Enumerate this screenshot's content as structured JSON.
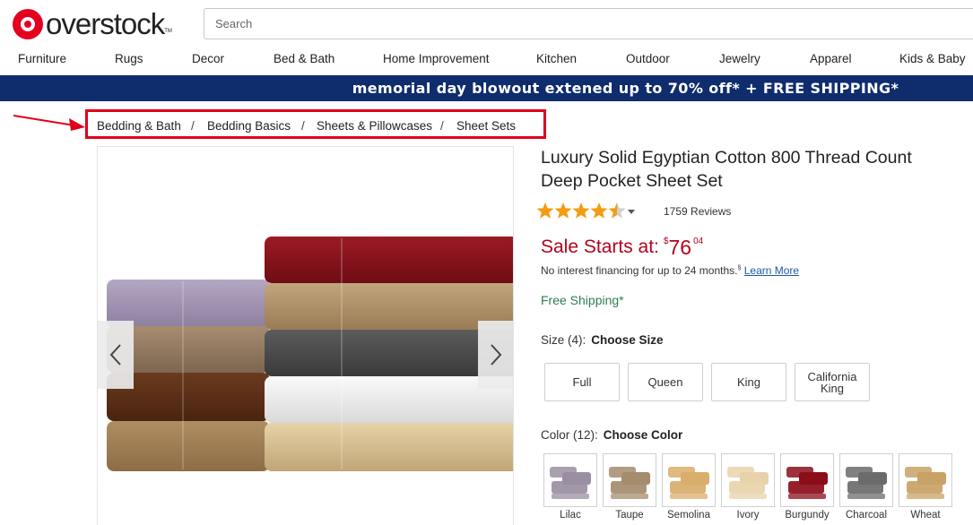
{
  "header": {
    "logo_text": "overstock",
    "logo_tm": "TM",
    "search_placeholder": "Search"
  },
  "nav": [
    "Furniture",
    "Rugs",
    "Decor",
    "Bed & Bath",
    "Home Improvement",
    "Kitchen",
    "Outdoor",
    "Jewelry",
    "Apparel",
    "Kids & Baby"
  ],
  "promo": "memorial day blowout extened up to 70% off* + FREE SHIPPING*",
  "breadcrumb": {
    "items": [
      "Bedding & Bath",
      "Bedding Basics",
      "Sheets & Pillowcases",
      "Sheet Sets"
    ],
    "separator": "/"
  },
  "gallery": {
    "prev_icon": "chevron-left-icon",
    "next_icon": "chevron-right-icon"
  },
  "product": {
    "title_line1": "Luxury Solid Egyptian Cotton 800 Thread Count",
    "title_line2": "Deep Pocket Sheet Set",
    "rating": 4.5,
    "reviews": "1759 Reviews",
    "price_label": "Sale Starts at:",
    "price_currency": "$",
    "price_int": "76",
    "price_cents": "04",
    "finance_text": "No interest financing for up to 24 months.",
    "finance_mark": "§",
    "learn_more": "Learn More",
    "shipping": "Free Shipping*"
  },
  "size": {
    "label": "Size (4):",
    "choose": "Choose Size",
    "options": [
      "Full",
      "Queen",
      "King",
      "California King"
    ]
  },
  "color": {
    "label": "Color (12):",
    "choose": "Choose Color",
    "options": [
      {
        "name": "Lilac",
        "hex": "#9a8fa2"
      },
      {
        "name": "Taupe",
        "hex": "#a48c6c"
      },
      {
        "name": "Semolina",
        "hex": "#d9ad6a"
      },
      {
        "name": "Ivory",
        "hex": "#e8d2aa"
      },
      {
        "name": "Burgundy",
        "hex": "#8c0d1a"
      },
      {
        "name": "Charcoal",
        "hex": "#6b6b6b"
      },
      {
        "name": "Wheat",
        "hex": "#c9a266"
      }
    ]
  },
  "colors": {
    "brand_red": "#e6001f",
    "promo_navy": "#0f2c6d",
    "price_red": "#b3001b",
    "star_orange": "#f39c12",
    "shipping_green": "#2f7d4f",
    "link_blue": "#1a5aa8"
  }
}
